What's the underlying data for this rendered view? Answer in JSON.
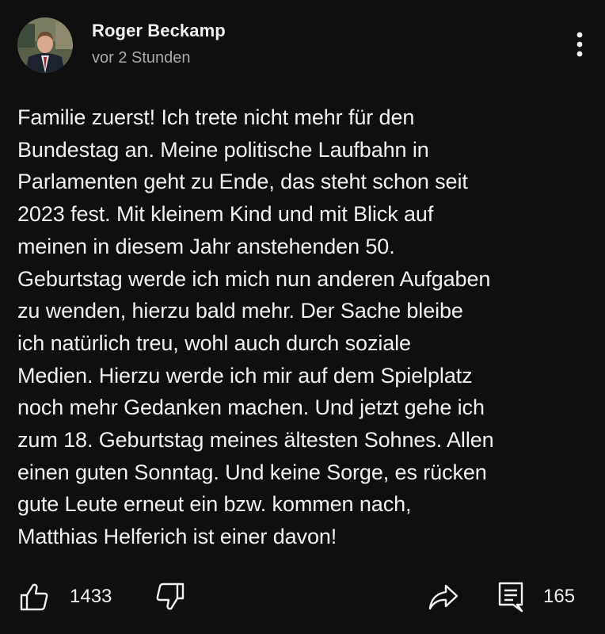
{
  "post": {
    "author": "Roger Beckamp",
    "timestamp": "vor 2 Stunden",
    "text": "Familie zuerst! Ich trete nicht mehr für den\nBundestag an. Meine politische Laufbahn in\nParlamenten geht zu Ende, das steht schon seit\n2023 fest. Mit kleinem Kind und mit Blick auf\nmeinen in diesem Jahr anstehenden 50.\nGeburtstag werde ich mich nun anderen Aufgaben\nzu wenden, hierzu bald mehr. Der Sache bleibe\nich natürlich treu, wohl auch durch soziale\nMedien. Hierzu werde ich mir auf dem Spielplatz\nnoch mehr Gedanken machen. Und jetzt gehe ich\nzum 18. Geburtstag meines ältesten Sohnes. Allen\neinen guten Sonntag. Und keine Sorge, es rücken\ngute Leute erneut ein bzw. kommen nach,\nMatthias Helferich ist einer davon!",
    "like_count": "1433",
    "comment_count": "165"
  },
  "icons": {
    "menu": "more-vert-icon",
    "like": "thumbs-up-icon",
    "dislike": "thumbs-down-icon",
    "share": "share-icon",
    "comments": "comment-icon"
  },
  "colors": {
    "background": "#0f0f0f",
    "text_primary": "#f1f1f1",
    "text_secondary": "#aaaaaa"
  }
}
